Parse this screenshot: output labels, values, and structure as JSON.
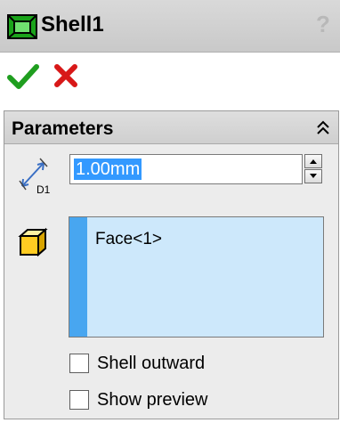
{
  "window": {
    "title": "Shell1",
    "help_label": "?"
  },
  "actions": {
    "ok": "confirm-icon",
    "cancel": "cancel-icon"
  },
  "parameters": {
    "header": "Parameters",
    "thickness": {
      "value": "1.00mm",
      "icon": "dimension-d1-icon",
      "icon_label": "D1"
    },
    "faces_to_remove": {
      "icon": "face-selection-icon",
      "items": [
        "Face<1>"
      ]
    },
    "shell_outward": {
      "label": "Shell outward",
      "checked": false
    },
    "show_preview": {
      "label": "Show preview",
      "checked": false
    }
  },
  "colors": {
    "accept": "#22aa22",
    "reject": "#dd1111",
    "selection": "#3399ff",
    "list_bg": "#cde8fb"
  }
}
